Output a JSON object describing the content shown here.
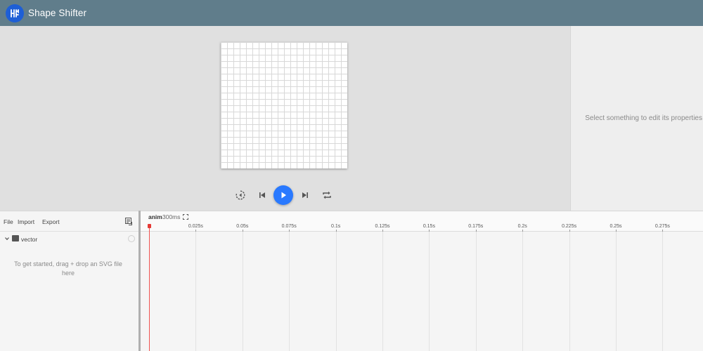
{
  "app": {
    "title": "Shape Shifter",
    "logo_icon": "shape-shifter-logo-icon",
    "header_color": "#607d8b"
  },
  "playback": {
    "buttons": [
      {
        "name": "reverse-play-icon",
        "label": "Rewind"
      },
      {
        "name": "skip-previous-icon",
        "label": "Jump to start"
      },
      {
        "name": "play-icon",
        "label": "Play"
      },
      {
        "name": "skip-next-icon",
        "label": "Jump to end"
      },
      {
        "name": "repeat-icon",
        "label": "Repeat"
      }
    ],
    "accent_color": "#2979ff"
  },
  "properties": {
    "empty_message": "Select something to edit its properties"
  },
  "layers": {
    "menu": [
      "File",
      "Import",
      "Export"
    ],
    "menu_action_icon": "layer-list-icon",
    "root_layer": {
      "name": "vector",
      "icon": "image-icon"
    },
    "empty_message": "To get started, drag + drop an SVG file here"
  },
  "timeline": {
    "animation": {
      "name": "anim",
      "duration": "300ms"
    },
    "fit_icon": "fullscreen-icon",
    "ticks": [
      "0.025s",
      "0.05s",
      "0.075s",
      "0.1s",
      "0.125s",
      "0.15s",
      "0.175s",
      "0.2s",
      "0.225s",
      "0.25s",
      "0.275s"
    ],
    "playhead_color": "#ef5350"
  }
}
